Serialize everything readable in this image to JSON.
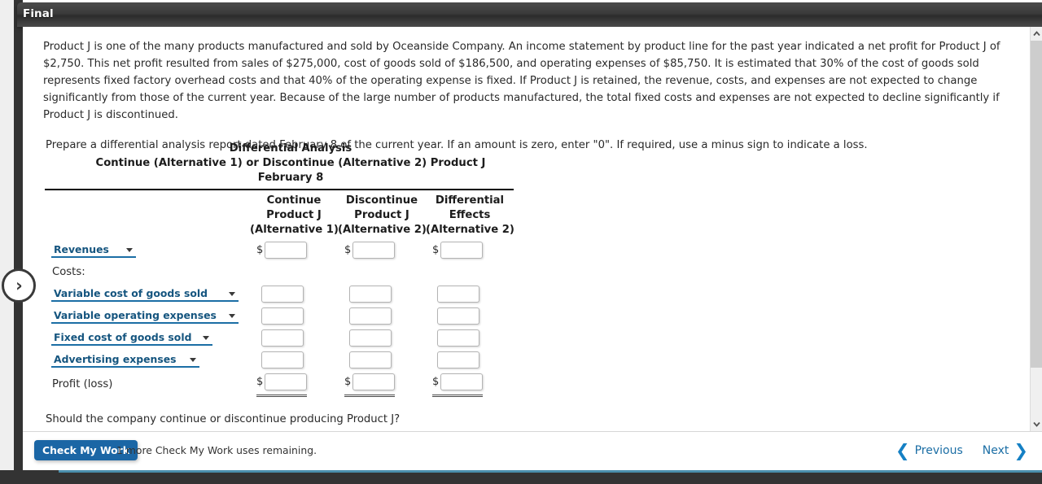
{
  "window": {
    "title": "Final"
  },
  "problem": {
    "paragraph": "Product J is one of the many products manufactured and sold by Oceanside Company. An income statement by product line for the past year indicated a net profit for Product J of $2,750. This net profit resulted from sales of $275,000, cost of goods sold of $186,500, and operating expenses of $85,750. It is estimated that 30% of the cost of goods sold represents fixed factory overhead costs and that 40% of the operating expense is fixed. If Product J is retained, the revenue, costs, and expenses are not expected to change significantly from those of the current year. Because of the large number of products manufactured, the total fixed costs and expenses are not expected to decline significantly if Product J is discontinued.",
    "instruction": "Prepare a differential analysis report dated February 8 of the current year. If an amount is zero, enter \"0\". If required, use a minus sign to indicate a loss.",
    "question": "Should the company continue or discontinue producing Product J?"
  },
  "statement": {
    "title_line_1": "Differential Analysis",
    "title_line_2": "Continue (Alternative 1) or Discontinue (Alternative 2) Product J",
    "title_line_3": "February 8",
    "columns": [
      {
        "line1": "Continue",
        "line2": "Product J",
        "line3": "(Alternative 1)"
      },
      {
        "line1": "Discontinue",
        "line2": "Product J",
        "line3": "(Alternative 2)"
      },
      {
        "line1": "Differential",
        "line2": "Effects",
        "line3": "(Alternative 2)"
      }
    ],
    "costs_header": "Costs:",
    "dollar_sign": "$",
    "rows": [
      {
        "type": "select",
        "label": "Revenues",
        "width_class": "w1",
        "show_dollar": true,
        "values": [
          "",
          "",
          ""
        ]
      },
      {
        "type": "select",
        "label": "Variable cost of goods sold",
        "width_class": "w3",
        "show_dollar": false,
        "values": [
          "",
          "",
          ""
        ]
      },
      {
        "type": "select",
        "label": "Variable operating expenses",
        "width_class": "w3",
        "show_dollar": false,
        "values": [
          "",
          "",
          ""
        ]
      },
      {
        "type": "select",
        "label": "Fixed cost of goods sold",
        "width_class": "w4",
        "show_dollar": false,
        "values": [
          "",
          "",
          ""
        ]
      },
      {
        "type": "select",
        "label": "Advertising expenses",
        "width_class": "w5",
        "show_dollar": false,
        "values": [
          "",
          "",
          ""
        ]
      },
      {
        "type": "plain",
        "label": "Profit (loss)",
        "show_dollar": true,
        "double_rule": true,
        "values": [
          "",
          "",
          ""
        ]
      }
    ]
  },
  "footer": {
    "check_my_work_label": "Check My Work",
    "uses_remaining_note": "1 more Check My Work uses remaining.",
    "previous_label": "Previous",
    "next_label": "Next",
    "prev_chevron": "❮",
    "next_chevron": "❯"
  },
  "expander": {
    "glyph": "›"
  },
  "colors": {
    "accent_blue": "#1b66a5",
    "link_blue": "#1b6ea5",
    "select_text": "#15557f",
    "titlebar_dark": "#333333",
    "bottom_accent": "#4b8fad"
  }
}
